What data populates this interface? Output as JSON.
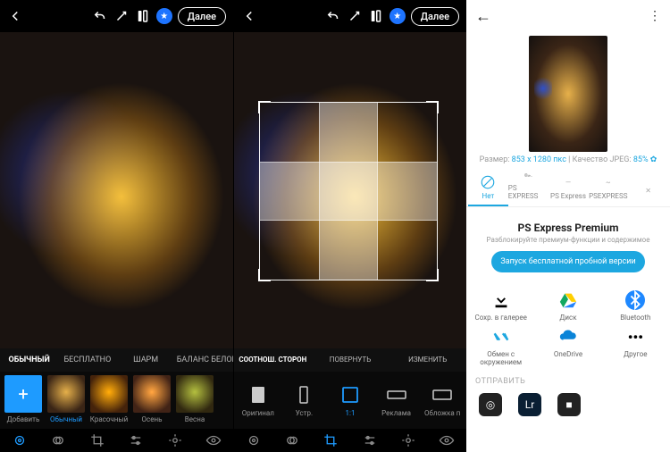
{
  "panel1": {
    "next": "Далее",
    "tabs": [
      "ОБЫЧНЫЙ",
      "БЕСПЛАТНО",
      "ШАРМ",
      "БАЛАНС БЕЛОГО"
    ],
    "activeTab": 0,
    "thumbs": [
      {
        "label": "Добавить",
        "type": "add"
      },
      {
        "label": "Обычный",
        "selected": true
      },
      {
        "label": "Красочный"
      },
      {
        "label": "Осень"
      },
      {
        "label": "Весна"
      }
    ]
  },
  "panel2": {
    "next": "Далее",
    "tabs": [
      {
        "label": "СООТНОШ. СТОРОН",
        "active": true
      },
      {
        "label": "ПОВЕРНУТЬ"
      },
      {
        "label": "ИЗМЕНИТЬ"
      }
    ],
    "ratios": [
      {
        "label": "Оригинал"
      },
      {
        "label": "Устр."
      },
      {
        "label": "1:1",
        "selected": true
      },
      {
        "label": "Реклама"
      },
      {
        "label": "Обложка п"
      }
    ]
  },
  "panel3": {
    "sizeLabel": "Размер:",
    "size": "853 x 1280 пкс",
    "qualityLabel": "Качество JPEG:",
    "quality": "85%",
    "watermarkTabs": [
      {
        "label": "Нет",
        "active": true
      },
      {
        "label": "PS EXPRESS"
      },
      {
        "label": "PS Express"
      },
      {
        "label": "PSEXPRESS"
      },
      {
        "label": ""
      }
    ],
    "premiumTitle": "PS Express Premium",
    "premiumSub": "Разблокируйте премиум-функции и содержимое",
    "premiumBtn": "Запуск бесплатной пробной версии",
    "shares": [
      {
        "label": "Сохр. в галерее",
        "icon": "download"
      },
      {
        "label": "Диск",
        "icon": "drive"
      },
      {
        "label": "Bluetooth",
        "icon": "bt"
      },
      {
        "label": "Обмен с окружением",
        "icon": "near"
      },
      {
        "label": "OneDrive",
        "icon": "onedrive"
      },
      {
        "label": "Другое",
        "icon": "more"
      }
    ],
    "sendHeader": "ОТПРАВИТЬ"
  }
}
